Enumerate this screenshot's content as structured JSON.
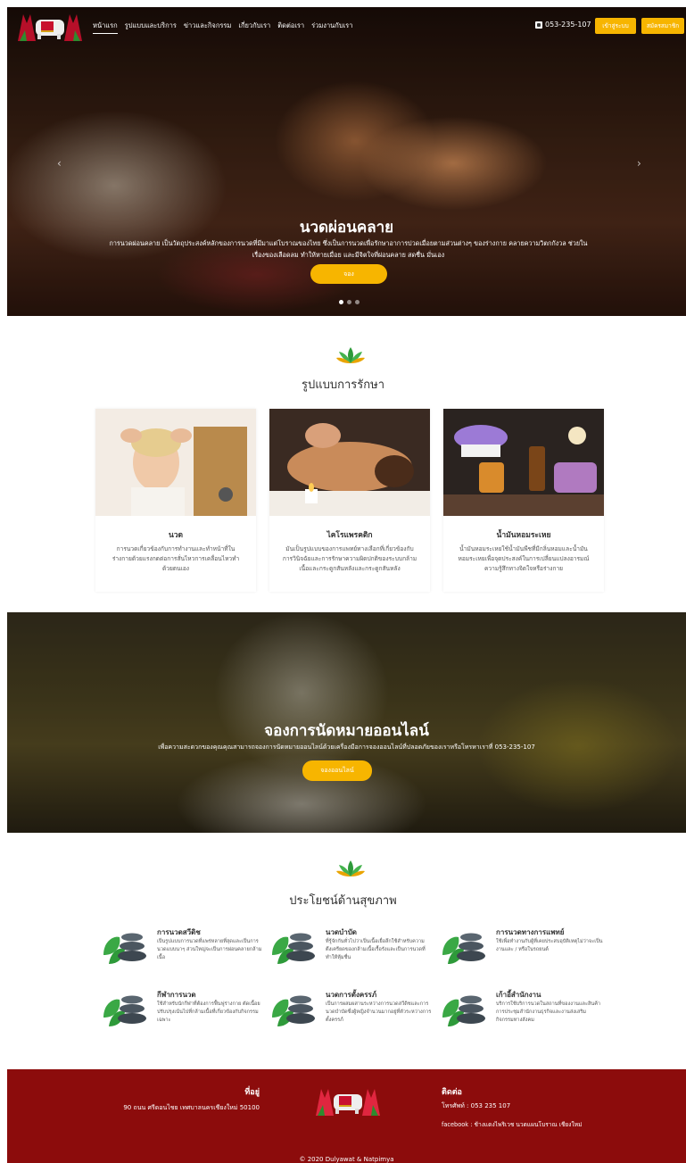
{
  "nav": {
    "items": [
      "หน้าแรก",
      "รูปแบบและบริการ",
      "ข่าวและกิจกรรม",
      "เกี่ยวกับเรา",
      "ติดต่อเรา",
      "ร่วมงานกับเรา"
    ],
    "phone": "053-235-107",
    "login": "เข้าสู่ระบบ",
    "register": "สมัครสมาชิก"
  },
  "hero": {
    "title": "นวดผ่อนคลาย",
    "description": "การนวดผ่อนคลาย เป็นวัตถุประสงค์หลักของการนวดที่มีมาแต่โบราณของไทย ซึ่งเป็นการนวดเพื่อรักษาอาการปวดเมื่อยตามส่วนต่างๆ ของร่างกาย คลายความวิตกกังวล ช่วยในเรื่องของเลือดลม ทำให้หายเมื่อย และมีจิตใจที่ผ่อนคลาย สดชื่น มั่นเอง",
    "button": "จอง",
    "slides": 3
  },
  "treatments": {
    "title": "รูปแบบการรักษา",
    "cards": [
      {
        "title": "นวด",
        "desc": "การนวดเกี่ยวข้องกับการทำงานและทำหน้าที่ในร่างกายด้วยแรงกดต่อการสั่นไหวการเคลื่อนไหวทำด้วยตนเอง"
      },
      {
        "title": "ไคโรแพรคติก",
        "desc": "มันเป็นรูปแบบของการแพทย์ทางเลือกที่เกี่ยวข้องกับการวินิจฉัยและการรักษาความผิดปกติของระบบกล้ามเนื้อและกระดูกสันหลังและกระดูกสันหลัง"
      },
      {
        "title": "น้ำมันหอมระเหย",
        "desc": "น้ำมันหอมระเหยใช้น้ำมันพืชที่มีกลิ่นหอมและน้ำมันหอมระเหยเพื่อจุดประสงค์ในการเปลี่ยนแปลงอารมณ์ความรู้สึกทางจิตใจหรือร่างกาย"
      }
    ]
  },
  "booking": {
    "title": "จองการนัดหมายออนไลน์",
    "description": "เพื่อความสะดวกของคุณคุณสามารถจองการนัดหมายออนไลน์ด้วยเครื่องมือการจองออนไลน์ที่ปลอดภัยของเราหรือโทรหาเราที่ 053-235-107",
    "button": "จองออนไลน์"
  },
  "benefits": {
    "title": "ประโยชน์ด้านสุขภาพ",
    "items": [
      {
        "title": "การนวดสวีดิช",
        "desc": "เป็นรูปแบบการนวดที่แพร่หลายที่สุดและเป็นการนวดแบบนาๆ ส่วนใหญ่จะเป็นการผ่อนคลายกล้ามเนื้อ"
      },
      {
        "title": "นวดบำบัด",
        "desc": "ที่รู้จักกันทั่วไปว่าเป็นเนื้อเยื่อลึกใช้สำหรับความตึงเครียดของกล้ามเนื้อเรื้อรังและเป็นการนวดที่ทำให้หุ้มชื่น"
      },
      {
        "title": "การนวดทางการแพทย์",
        "desc": "ใช้เพื่อทำงานกับผู้ที่เคยประสบอุบัติเหตุไม่ว่าจะเป็นงานและ / หรือในรถยนต์"
      },
      {
        "title": "กีฬาการนวด",
        "desc": "ใช้สำหรับนักกีฬาที่ต้องการฟื้นฟูร่างกาย ตัดเนื้อย ปรับปรุงเน้นไปที่กล้ามเนื้อที่เกี่ยวข้องกับกิจกรรมเฉพาะ"
      },
      {
        "title": "นวดการตั้งครรภ์",
        "desc": "เป็นการผสมผสานระหว่างการนวดสวีดิชและการนวดบำบัดซึ่งผู้หญิงจำนวนมากอยู่ที่ตัวระหว่างการตั้งครรภ์"
      },
      {
        "title": "เก้าอี้สำนักงาน",
        "desc": "บริการใช้บริการนวดในสถานที่ของงานและสินค้าการประชุมสำนักงานธุรกิจและงานส่งเสริมกิจกรรมทางสังคม"
      }
    ]
  },
  "footer": {
    "address_title": "ที่อยู่",
    "address": "90 ถนน ศรีดอนไชย เทศบาลนครเชียงใหม่ 50100",
    "contact_title": "ติดต่อ",
    "phone": "โทรศัพท์ : 053 235 107",
    "facebook": "facebook : ช้างแดงไพริเวช นวดแผนโบราณ เชียงใหม่",
    "copyright": "© 2020 Dulyawat & Natpimya"
  },
  "colors": {
    "accent": "#f7b500",
    "footer": "#8c0c0c",
    "leaf": "#2e9a3a"
  }
}
